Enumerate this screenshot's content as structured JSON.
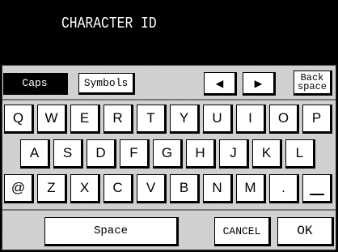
{
  "header": {
    "title": "CHARACTER ID"
  },
  "toolbar": {
    "caps": "Caps",
    "symbols": "Symbols",
    "left_arrow": "◀",
    "right_arrow": "▶",
    "back_line1": "Back",
    "back_line2": "space"
  },
  "keyboard": {
    "row1": [
      "Q",
      "W",
      "E",
      "R",
      "T",
      "Y",
      "U",
      "I",
      "O",
      "P"
    ],
    "row2": [
      "A",
      "S",
      "D",
      "F",
      "G",
      "H",
      "J",
      "K",
      "L"
    ],
    "row3": [
      "@",
      "Z",
      "X",
      "C",
      "V",
      "B",
      "N",
      "M",
      ".",
      " "
    ]
  },
  "bottom": {
    "space": "Space",
    "cancel": "CANCEL",
    "ok": "OK"
  }
}
